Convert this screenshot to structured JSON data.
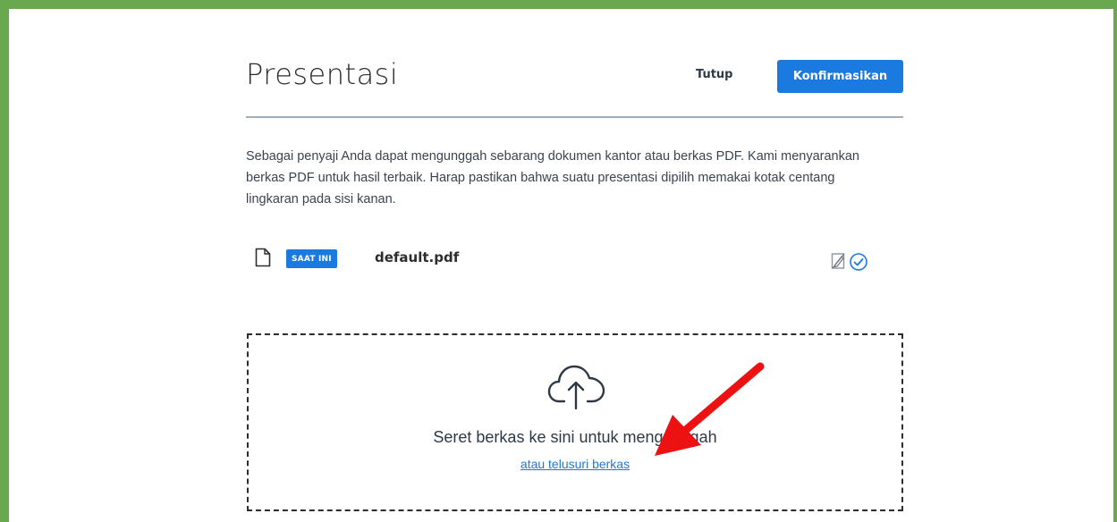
{
  "modal": {
    "title": "Presentasi",
    "close_label": "Tutup",
    "confirm_label": "Konfirmasikan",
    "description": "Sebagai penyaji Anda dapat mengunggah sebarang dokumen kantor atau berkas PDF. Kami menyarankan berkas PDF untuk hasil terbaik. Harap pastikan bahwa suatu presentasi dipilih memakai kotak centang lingkaran pada sisi kanan."
  },
  "files": [
    {
      "badge": "SAAT INI",
      "name": "default.pdf",
      "icons": [
        "file-icon",
        "edit-disabled-icon",
        "check-circle-icon"
      ]
    }
  ],
  "dropzone": {
    "text": "Seret berkas ke sini untuk mengunggah",
    "browse_label": "atau telusuri berkas",
    "icon": "cloud-upload-icon"
  },
  "colors": {
    "frame_border": "#6aa84f",
    "accent": "#1b7ae0",
    "annotation_arrow": "#ee1111"
  }
}
